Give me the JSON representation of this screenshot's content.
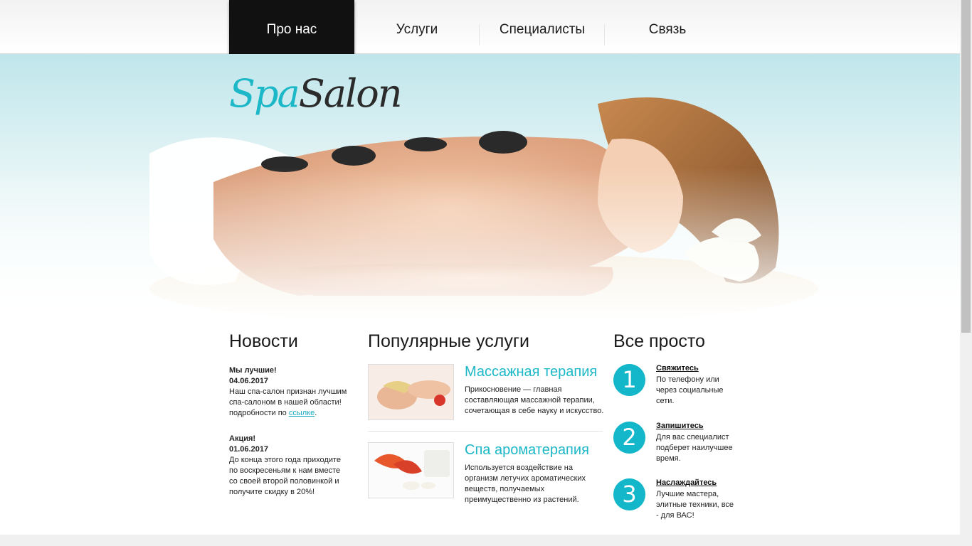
{
  "nav": {
    "items": [
      {
        "label": "Про нас",
        "active": true
      },
      {
        "label": "Услуги"
      },
      {
        "label": "Специалисты"
      },
      {
        "label": "Связь"
      }
    ]
  },
  "logo": {
    "spa": "Spa",
    "salon": "Salon"
  },
  "news": {
    "heading": "Новости",
    "items": [
      {
        "title": "Мы лучшие!",
        "date": "04.06.2017",
        "text": "Наш спа-салон признан лучшим спа-салоном в нашей области! подробности по ",
        "link": "ссылке",
        "after": "."
      },
      {
        "title": "Акция!",
        "date": "01.06.2017",
        "text": "До конца этого года приходите по воскресеньям к нам вместе со своей второй половинкой и получите скидку в 20%!"
      }
    ]
  },
  "services": {
    "heading": "Популярные услуги",
    "items": [
      {
        "title": "Массажная терапия",
        "desc": "Прикосновение — главная составляющая массажной терапии, сочетающая в себе науку и искусство."
      },
      {
        "title": "Спа ароматерапия",
        "desc": "Используется воздействие на организм летучих ароматических веществ, получаемых преимущественно из растений."
      }
    ]
  },
  "steps": {
    "heading": "Все просто",
    "items": [
      {
        "num": "1",
        "title": "Свяжитесь",
        "desc": "По телефону или через социальные сети."
      },
      {
        "num": "2",
        "title": "Запишитесь",
        "desc": "Для вас специалист подберет наилучшее время."
      },
      {
        "num": "3",
        "title": "Наслаждайтесь",
        "desc": "Лучшие мастера, элитные техники, все - для ВАС!"
      }
    ]
  },
  "colors": {
    "accent": "#1cb8c8",
    "nav_active": "#111111"
  }
}
